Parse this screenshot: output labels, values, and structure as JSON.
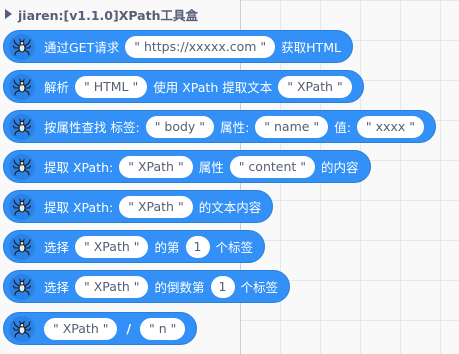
{
  "palette": {
    "header_title": "jiaren:[v1.1.0]XPath工具盒"
  },
  "blocks": {
    "request": {
      "label1": "通过GET请求",
      "url": "\" https://xxxxx.com \"",
      "label2": "获取HTML"
    },
    "parse": {
      "label1": "解析",
      "html": "\" HTML \"",
      "label2": "使用 XPath 提取文本",
      "xpath": "\" XPath \""
    },
    "find_by_attr": {
      "label1": "按属性查找 标签:",
      "tag": "\" body \"",
      "label2": "属性:",
      "attr": "\" name \"",
      "label3": "值:",
      "value": "\" xxxx \""
    },
    "extract_attr": {
      "label1": "提取 XPath:",
      "xpath": "\" XPath \"",
      "label2": "属性",
      "attr": "\" content \"",
      "label3": "的内容"
    },
    "extract_text": {
      "label1": "提取 XPath:",
      "xpath": "\" XPath \"",
      "label2": "的文本内容"
    },
    "select_nth": {
      "label1": "选择",
      "xpath": "\" XPath \"",
      "label2": "的第",
      "n": "1",
      "label3": "个标签"
    },
    "select_nth_last": {
      "label1": "选择",
      "xpath": "\" XPath \"",
      "label2": "的倒数第",
      "n": "1",
      "label3": "个标签"
    },
    "join_path": {
      "xpath": "\" XPath \"",
      "separator": "/",
      "n": "\" n \""
    }
  },
  "colors": {
    "block_fill": "#3390f6",
    "block_border": "#2a7ed8",
    "field_text": "#575e75",
    "canvas_grid": "#e7e7ea"
  },
  "icons": {
    "block_icon": "spider-icon"
  }
}
